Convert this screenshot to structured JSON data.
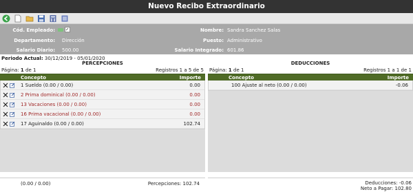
{
  "title": "Nuevo Recibo Extraordinario",
  "toolbar": {
    "icons": [
      "back-icon",
      "new-icon",
      "open-icon",
      "save-icon",
      "calculator-icon",
      "list-icon"
    ],
    "colors": {
      "back": "#3aa34a"
    }
  },
  "employee": {
    "cod_label": "Cód. Empleado:",
    "depto_label": "Departamento:",
    "depto_value": "Dirección",
    "salario_label": "Salario Diario:",
    "salario_value": "500.00",
    "nombre_label": "Nombre:",
    "nombre_value": "Sandra Sanchez Salas",
    "puesto_label": "Puesto:",
    "puesto_value": "Administrativo",
    "salario_int_label": "Salario Integrado:",
    "salario_int_value": "601.86"
  },
  "periodo": {
    "label": "Periodo Actual:",
    "value": "30/12/2019 - 05/01/2020"
  },
  "percepciones": {
    "title": "PERCEPCIONES",
    "page_label": "Página:",
    "page": "1",
    "of": "de 1",
    "registros": "Registros 1 a 5 de 5",
    "col_concepto": "Concepto",
    "col_importe": "Importe",
    "rows": [
      {
        "concepto": "1 Sueldo (0.00 / 0.00)",
        "importe": "0.00",
        "red": false
      },
      {
        "concepto": "2 Prima dominical (0.00 / 0.00)",
        "importe": "0.00",
        "red": true
      },
      {
        "concepto": "13 Vacaciones (0.00 / 0.00)",
        "importe": "0.00",
        "red": true
      },
      {
        "concepto": "16 Prima vacacional (0.00 / 0.00)",
        "importe": "0.00",
        "red": true
      },
      {
        "concepto": "17 Aguinaldo (0.00 / 0.00)",
        "importe": "102.74",
        "red": false
      }
    ],
    "footer_left": "(0.00 / 0.00)",
    "footer_total": "Percepciones: 102.74"
  },
  "deducciones": {
    "title": "DEDUCCIONES",
    "page_label": "Página:",
    "page": "1",
    "of": "de 1",
    "registros": "Registros 1 a 1 de 1",
    "col_concepto": "Concepto",
    "col_importe": "Importe",
    "rows": [
      {
        "concepto": "100 Ajuste al neto (0.00 / 0.00)",
        "importe": "-0.06",
        "red": false
      }
    ],
    "footer_total": "Deducciones: -0.06",
    "footer_neto": "Neto a Pagar: 102.80"
  }
}
